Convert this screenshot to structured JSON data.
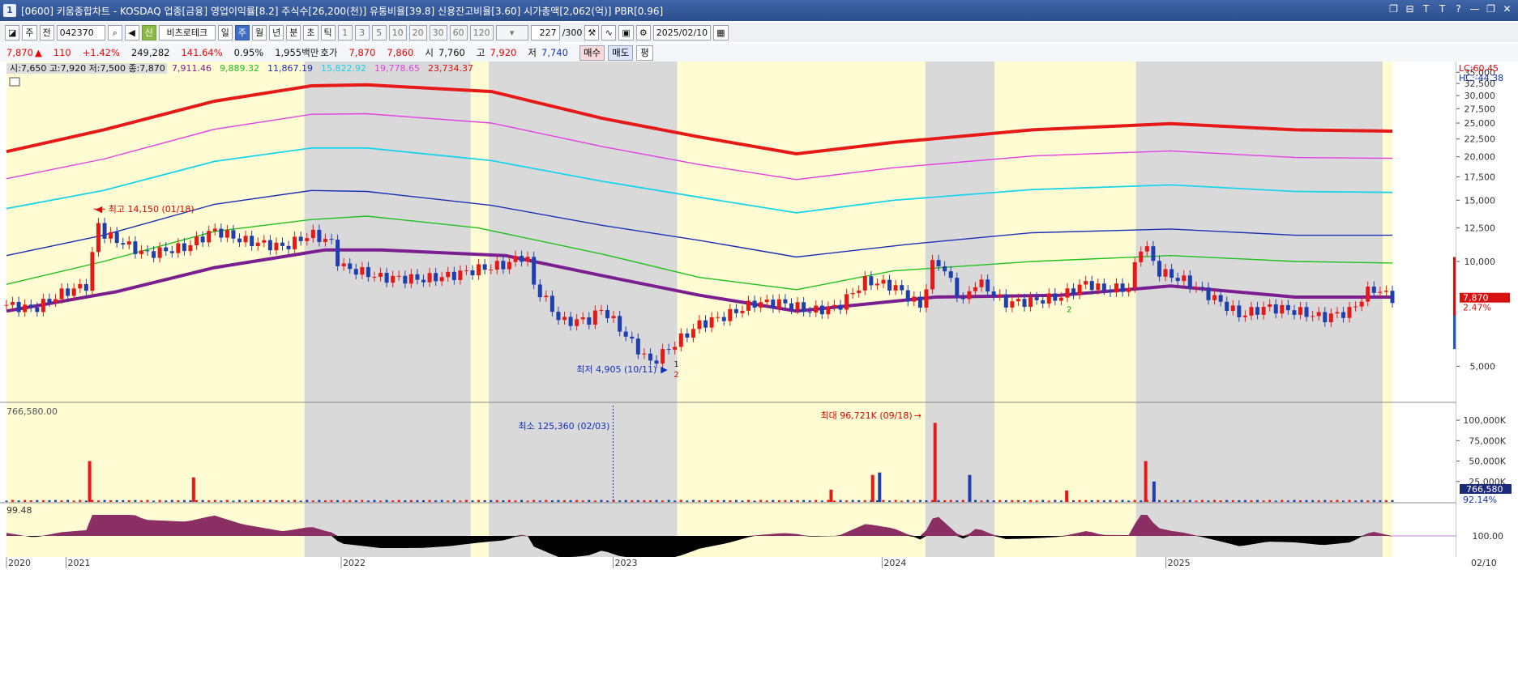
{
  "window": {
    "title": "[0600] 키움종합차트 - KOSDAQ 업종[금융] 영업이익률[8.2] 주식수[26,200(천)] 유통비율[39.8] 신용잔고비율[3.60] 시가총액[2,062(억)] PBR[0.96]",
    "icon_text": "1",
    "buttons": [
      "❐",
      "⊟",
      "T",
      "T",
      "?",
      "—",
      "❐",
      "✕"
    ]
  },
  "toolbar": {
    "mode": "주",
    "prev": "전",
    "code": "042370",
    "sin_label": "신",
    "name": "비츠로테크",
    "periods": [
      "일",
      "주",
      "월",
      "년",
      "분",
      "초",
      "틱"
    ],
    "active_period": "주",
    "intervals": [
      "1",
      "3",
      "5",
      "10",
      "20",
      "30",
      "60",
      "120"
    ],
    "count": "227",
    "count_total": "/300",
    "date": "2025/02/10"
  },
  "quote": {
    "price": "7,870",
    "arrow": "▲",
    "change": "110",
    "change_pct": "+1.42%",
    "volume": "249,282",
    "vol_ratio": "141.64%",
    "turnover": "0.95%",
    "amount": "1,955백만",
    "ask_label": "호가",
    "ask": "7,870",
    "bid": "7,860",
    "open_label": "시",
    "open": "7,760",
    "high_label": "고",
    "high": "7,920",
    "low_label": "저",
    "low": "7,740",
    "buy": "매수",
    "sell": "매도",
    "eval": "평"
  },
  "legend": {
    "ohlc": "시:7,650 고:7,920 저:7,500 종:7,870",
    "ma": [
      {
        "text": "7,911.46",
        "color": "#7a1f8f"
      },
      {
        "text": "9,889.32",
        "color": "#1fc01f"
      },
      {
        "text": "11,867.19",
        "color": "#1b2fb3"
      },
      {
        "text": "15,822.92",
        "color": "#19d3ea"
      },
      {
        "text": "19,778.65",
        "color": "#e040e0"
      },
      {
        "text": "23,734.37",
        "color": "#e01010"
      }
    ]
  },
  "price_axis": {
    "labels": [
      "35,000",
      "32,500",
      "30,000",
      "27,500",
      "25,000",
      "22,500",
      "20,000",
      "17,500",
      "15,000",
      "12,500",
      "10,000",
      "5,000"
    ],
    "lc": "LC:60.45",
    "hc": "HC:-44.38",
    "current": "7,870",
    "current_pct": "2.47%"
  },
  "annotations": {
    "high": "최고 14,150 (01/18)",
    "low": "최저 4,905 (10/11)",
    "marker1": "1",
    "marker2": "2",
    "marker3": "2",
    "vol_min": "최소 125,360 (02/03)",
    "vol_max": "최대 96,721K (09/18)"
  },
  "volume_axis": {
    "top_label": "766,580.00",
    "labels": [
      "100,000K",
      "75,000K",
      "50,000K",
      "25,000K"
    ],
    "current": "766,580",
    "pct": "92.14%"
  },
  "osc_axis": {
    "top_label": "99.48",
    "label": "100.00"
  },
  "x_axis": [
    "2020",
    "2021",
    "2022",
    "2023",
    "2024",
    "2025",
    "02/10"
  ],
  "colors": {
    "up": "#e61919",
    "down": "#1f3fb0",
    "shade_gray": "#d9d9d9",
    "shade_yellow": "#fffbd2"
  },
  "chart_data": {
    "type": "candlestick",
    "period": "weekly",
    "price_ylim": [
      4000,
      36000
    ],
    "shade_bands": [
      {
        "from": "2020",
        "to": "2021-09",
        "color": "yellow"
      },
      {
        "from": "2021-09",
        "to": "2022-05",
        "color": "gray"
      },
      {
        "from": "2022-05",
        "to": "2022-06",
        "color": "yellow"
      },
      {
        "from": "2022-06",
        "to": "2023-01",
        "color": "gray"
      },
      {
        "from": "2023-01",
        "to": "2023-10",
        "color": "yellow"
      },
      {
        "from": "2023-10",
        "to": "2024-01",
        "color": "gray"
      },
      {
        "from": "2024-01",
        "to": "2024-07",
        "color": "yellow"
      },
      {
        "from": "2024-07",
        "to": "2025-01",
        "color": "gray"
      },
      {
        "from": "2025-01",
        "to": "2025-02",
        "color": "yellow"
      }
    ],
    "moving_averages": [
      {
        "name": "7,911.46",
        "color": "#7a1f8f",
        "points": [
          [
            0,
            7200
          ],
          [
            0.08,
            8200
          ],
          [
            0.15,
            9600
          ],
          [
            0.23,
            10800
          ],
          [
            0.27,
            10800
          ],
          [
            0.36,
            10400
          ],
          [
            0.43,
            9100
          ],
          [
            0.5,
            8000
          ],
          [
            0.57,
            7200
          ],
          [
            0.67,
            7900
          ],
          [
            0.76,
            8000
          ],
          [
            0.84,
            8500
          ],
          [
            0.93,
            7900
          ],
          [
            1,
            7900
          ]
        ]
      },
      {
        "name": "9,889.32",
        "color": "#1fc01f",
        "points": [
          [
            0,
            8600
          ],
          [
            0.07,
            10000
          ],
          [
            0.15,
            12200
          ],
          [
            0.22,
            13200
          ],
          [
            0.26,
            13500
          ],
          [
            0.34,
            12500
          ],
          [
            0.43,
            10500
          ],
          [
            0.5,
            9000
          ],
          [
            0.57,
            8300
          ],
          [
            0.64,
            9400
          ],
          [
            0.74,
            10000
          ],
          [
            0.84,
            10400
          ],
          [
            0.93,
            10000
          ],
          [
            1,
            9900
          ]
        ]
      },
      {
        "name": "11,867.19",
        "color": "#1b2fb3",
        "points": [
          [
            0,
            10400
          ],
          [
            0.07,
            11900
          ],
          [
            0.15,
            14600
          ],
          [
            0.22,
            16000
          ],
          [
            0.26,
            15900
          ],
          [
            0.35,
            14500
          ],
          [
            0.43,
            12700
          ],
          [
            0.5,
            11500
          ],
          [
            0.57,
            10300
          ],
          [
            0.65,
            11200
          ],
          [
            0.74,
            12100
          ],
          [
            0.84,
            12400
          ],
          [
            0.93,
            11900
          ],
          [
            1,
            11900
          ]
        ]
      },
      {
        "name": "15,822.92",
        "color": "#19d3ea",
        "points": [
          [
            0,
            14200
          ],
          [
            0.07,
            16000
          ],
          [
            0.15,
            19400
          ],
          [
            0.22,
            21200
          ],
          [
            0.26,
            21200
          ],
          [
            0.35,
            19500
          ],
          [
            0.43,
            17000
          ],
          [
            0.5,
            15300
          ],
          [
            0.57,
            13800
          ],
          [
            0.64,
            15000
          ],
          [
            0.74,
            16100
          ],
          [
            0.84,
            16600
          ],
          [
            0.93,
            15900
          ],
          [
            1,
            15800
          ]
        ]
      },
      {
        "name": "19,778.65",
        "color": "#e040e0",
        "points": [
          [
            0,
            17300
          ],
          [
            0.07,
            19700
          ],
          [
            0.15,
            24000
          ],
          [
            0.22,
            26500
          ],
          [
            0.26,
            26600
          ],
          [
            0.35,
            25000
          ],
          [
            0.43,
            21400
          ],
          [
            0.5,
            19000
          ],
          [
            0.57,
            17200
          ],
          [
            0.64,
            18600
          ],
          [
            0.74,
            20100
          ],
          [
            0.84,
            20800
          ],
          [
            0.93,
            19900
          ],
          [
            1,
            19800
          ]
        ]
      },
      {
        "name": "23,734.37",
        "color": "#e61919",
        "points": [
          [
            0,
            20700
          ],
          [
            0.07,
            23900
          ],
          [
            0.15,
            28900
          ],
          [
            0.22,
            32000
          ],
          [
            0.26,
            32200
          ],
          [
            0.35,
            30800
          ],
          [
            0.43,
            25800
          ],
          [
            0.5,
            22800
          ],
          [
            0.57,
            20400
          ],
          [
            0.64,
            22000
          ],
          [
            0.74,
            23900
          ],
          [
            0.84,
            24900
          ],
          [
            0.93,
            23900
          ],
          [
            1,
            23700
          ]
        ]
      }
    ],
    "candles_outline": [
      [
        0,
        7500
      ],
      [
        0.02,
        7300
      ],
      [
        0.04,
        8100
      ],
      [
        0.06,
        8600
      ],
      [
        0.065,
        13200
      ],
      [
        0.07,
        12000
      ],
      [
        0.1,
        10500
      ],
      [
        0.13,
        11000
      ],
      [
        0.15,
        12300
      ],
      [
        0.17,
        11500
      ],
      [
        0.2,
        11000
      ],
      [
        0.22,
        12000
      ],
      [
        0.235,
        11300
      ],
      [
        0.24,
        9700
      ],
      [
        0.27,
        9000
      ],
      [
        0.3,
        8900
      ],
      [
        0.32,
        9100
      ],
      [
        0.34,
        9500
      ],
      [
        0.36,
        9800
      ],
      [
        0.375,
        10500
      ],
      [
        0.38,
        8600
      ],
      [
        0.4,
        6700
      ],
      [
        0.42,
        6800
      ],
      [
        0.43,
        7300
      ],
      [
        0.45,
        5900
      ],
      [
        0.465,
        5100
      ],
      [
        0.48,
        5700
      ],
      [
        0.5,
        6600
      ],
      [
        0.52,
        7000
      ],
      [
        0.54,
        7600
      ],
      [
        0.56,
        7600
      ],
      [
        0.58,
        7200
      ],
      [
        0.6,
        7400
      ],
      [
        0.62,
        8800
      ],
      [
        0.64,
        8500
      ],
      [
        0.66,
        7400
      ],
      [
        0.67,
        10300
      ],
      [
        0.69,
        7600
      ],
      [
        0.7,
        8800
      ],
      [
        0.72,
        7600
      ],
      [
        0.74,
        7700
      ],
      [
        0.76,
        7900
      ],
      [
        0.78,
        8700
      ],
      [
        0.79,
        8300
      ],
      [
        0.81,
        8400
      ],
      [
        0.82,
        11500
      ],
      [
        0.83,
        9400
      ],
      [
        0.85,
        8800
      ],
      [
        0.87,
        7900
      ],
      [
        0.89,
        7000
      ],
      [
        0.91,
        7400
      ],
      [
        0.93,
        7200
      ],
      [
        0.95,
        6900
      ],
      [
        0.97,
        7200
      ],
      [
        0.985,
        8400
      ],
      [
        1,
        7870
      ]
    ],
    "volume_unit": "K",
    "volume_ylim": [
      0,
      110000
    ],
    "volume_spikes": [
      {
        "x": 0.06,
        "value": 50000,
        "color": "up"
      },
      {
        "x": 0.135,
        "value": 30000,
        "color": "up"
      },
      {
        "x": 0.595,
        "value": 15000,
        "color": "up"
      },
      {
        "x": 0.625,
        "value": 33000,
        "color": "up"
      },
      {
        "x": 0.63,
        "value": 36000,
        "color": "down"
      },
      {
        "x": 0.67,
        "value": 96721,
        "color": "up"
      },
      {
        "x": 0.695,
        "value": 33000,
        "color": "down"
      },
      {
        "x": 0.765,
        "value": 14000,
        "color": "up"
      },
      {
        "x": 0.822,
        "value": 50000,
        "color": "up"
      },
      {
        "x": 0.828,
        "value": 25000,
        "color": "down"
      }
    ]
  }
}
